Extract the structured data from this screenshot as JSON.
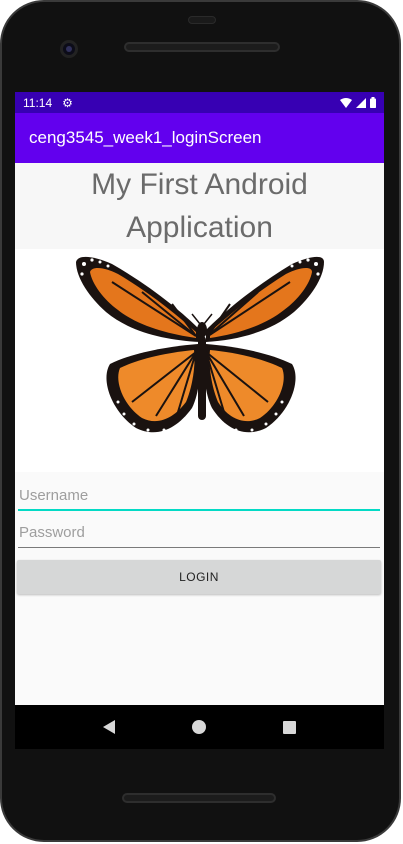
{
  "status_bar": {
    "time": "11:14",
    "icons": [
      "settings-gear-icon",
      "wifi-icon",
      "signal-icon",
      "battery-icon"
    ]
  },
  "app_bar": {
    "title": "ceng3545_week1_loginScreen",
    "color": "#6200ee"
  },
  "header": {
    "line1": "My First Android",
    "line2": "Application"
  },
  "image": {
    "icon": "monarch-butterfly-image"
  },
  "form": {
    "username_placeholder": "Username",
    "password_placeholder": "Password",
    "login_label": "LOGIN"
  },
  "nav": {
    "icons": [
      "back-icon",
      "home-icon",
      "recents-icon"
    ]
  },
  "colors": {
    "status_bar": "#3700b3",
    "accent": "#03dac5",
    "button": "#d6d7d7"
  }
}
